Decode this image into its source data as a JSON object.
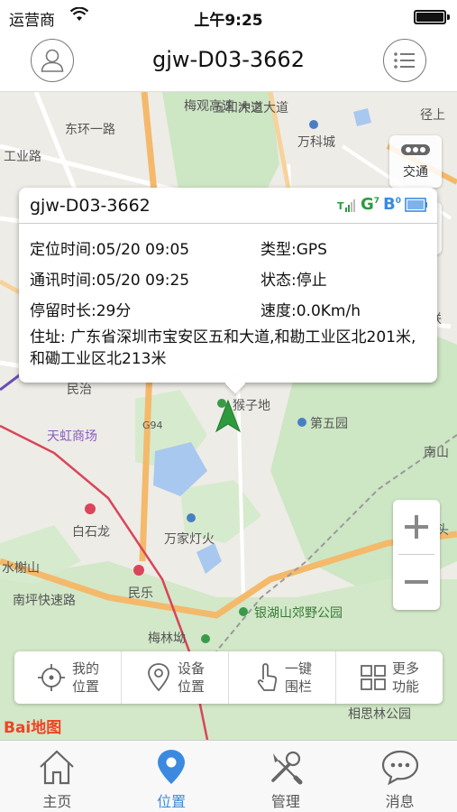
{
  "status_bar": {
    "carrier": "运营商",
    "time": "上午9:25"
  },
  "header": {
    "title": "gjw-D03-3662"
  },
  "map": {
    "labels": {
      "wanke": "万科城",
      "houzidi": "猴子地",
      "diwuyuan": "第五园",
      "tianhong": "天虹商场",
      "baishilong": "白石龙",
      "wanjiadenghuo": "万家灯火",
      "minle": "民乐",
      "shuixie": "水榭山",
      "nanping": "南坪快速路",
      "yinhu": "银湖山郊野公园",
      "meilinao": "梅林坳",
      "xiangsilin": "相思林公园",
      "meiguan": "梅观高速",
      "wuhe": "五和大道",
      "chongzhi": "冲之大道",
      "donghuan": "东环一路",
      "gongye": "工业路",
      "g94": "G94",
      "jingshang": "径上",
      "nanlian": "南联",
      "minzhi": "民治",
      "nan": "南山",
      "gong": "公头"
    },
    "traffic_label": "交通",
    "type_label": "类型",
    "logo": "Bai地图"
  },
  "popup": {
    "title": "gjw-D03-3662",
    "locate_time": "定位时间:05/20 09:05",
    "type": "类型:GPS",
    "comm_time": "通讯时间:05/20 09:25",
    "state": "状态:停止",
    "stay": "停留时长:29分",
    "speed": "速度:0.0Km/h",
    "address": "住址: 广东省深圳市宝安区五和大道,和勘工业区北201米,和磡工业区北213米",
    "gsm_sup": "7",
    "bt_sup": "0"
  },
  "toolbar": [
    {
      "line1": "我的",
      "line2": "位置",
      "icon": "crosshair-icon"
    },
    {
      "line1": "设备",
      "line2": "位置",
      "icon": "map-pin-icon"
    },
    {
      "line1": "一键",
      "line2": "围栏",
      "icon": "touch-icon"
    },
    {
      "line1": "更多",
      "line2": "功能",
      "icon": "grid-icon"
    }
  ],
  "tabs": [
    {
      "label": "主页",
      "icon": "home-icon",
      "active": false
    },
    {
      "label": "位置",
      "icon": "location-icon",
      "active": true
    },
    {
      "label": "管理",
      "icon": "tools-icon",
      "active": false
    },
    {
      "label": "消息",
      "icon": "chat-icon",
      "active": false
    }
  ],
  "colors": {
    "accent": "#3b8ae0",
    "marker": "#2e9a3e",
    "park": "#cde6c4",
    "water": "#a8c8f0",
    "highway": "#f4b96a"
  }
}
